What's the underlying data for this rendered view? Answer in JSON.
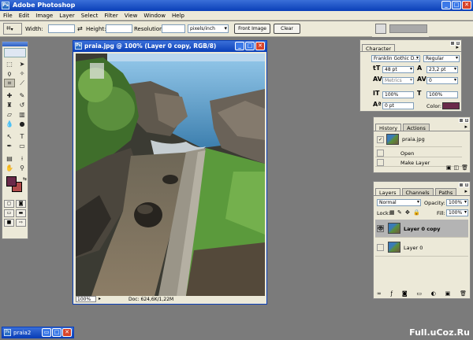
{
  "app": {
    "title": "Adobe Photoshop",
    "logo": "Ps",
    "window_controls": [
      "_",
      "□",
      "✕"
    ]
  },
  "menu": [
    "File",
    "Edit",
    "Image",
    "Layer",
    "Select",
    "Filter",
    "View",
    "Window",
    "Help"
  ],
  "options_bar": {
    "tool_icon": "crop-icon",
    "width_label": "Width:",
    "width_value": "",
    "height_label": "Height:",
    "height_value": "",
    "resolution_label": "Resolution:",
    "resolution_value": "",
    "units_value": "pixels/inch",
    "front_image_label": "Front Image",
    "clear_label": "Clear"
  },
  "toolbox": {
    "tools": [
      "marquee-icon",
      "move-icon",
      "lasso-icon",
      "magic-wand-icon",
      "crop-icon",
      "slice-icon",
      "healing-icon",
      "brush-icon",
      "stamp-icon",
      "history-brush-icon",
      "eraser-icon",
      "gradient-icon",
      "blur-icon",
      "dodge-icon",
      "path-select-icon",
      "type-icon",
      "pen-icon",
      "shape-icon",
      "notes-icon",
      "eyedropper-icon",
      "hand-icon",
      "zoom-icon"
    ],
    "foreground_color": "#6a2a4a",
    "background_color": "#b04a4a"
  },
  "document": {
    "title": "praia.jpg @ 100% (Layer 0 copy, RGB/8)",
    "zoom": "100%",
    "doc_info": "Doc: 624,6K/1,22M"
  },
  "character_panel": {
    "tab": "Character",
    "font_family": "Franklin Gothic D...",
    "font_style": "Regular",
    "size": "48 pt",
    "leading": "23,2 pt",
    "kerning": "Metrics",
    "tracking": "0",
    "vscale": "100%",
    "hscale": "100%",
    "baseline": "0 pt",
    "color_label": "Color:",
    "color": "#6a2a4a"
  },
  "history_panel": {
    "tabs": [
      "History",
      "Actions"
    ],
    "snapshot": "praia.jpg",
    "states": [
      "Open",
      "Make Layer"
    ]
  },
  "layers_panel": {
    "tabs": [
      "Layers",
      "Channels",
      "Paths"
    ],
    "blend_mode": "Normal",
    "opacity_label": "Opacity:",
    "opacity": "100%",
    "lock_label": "Lock:",
    "fill_label": "Fill:",
    "fill": "100%",
    "layers": [
      {
        "name": "Layer 0 copy",
        "selected": true,
        "visible": true
      },
      {
        "name": "Layer 0",
        "selected": false,
        "visible": false
      }
    ]
  },
  "minimized_window": {
    "title": "praia2"
  },
  "watermark": "Full.uCoz.Ru"
}
